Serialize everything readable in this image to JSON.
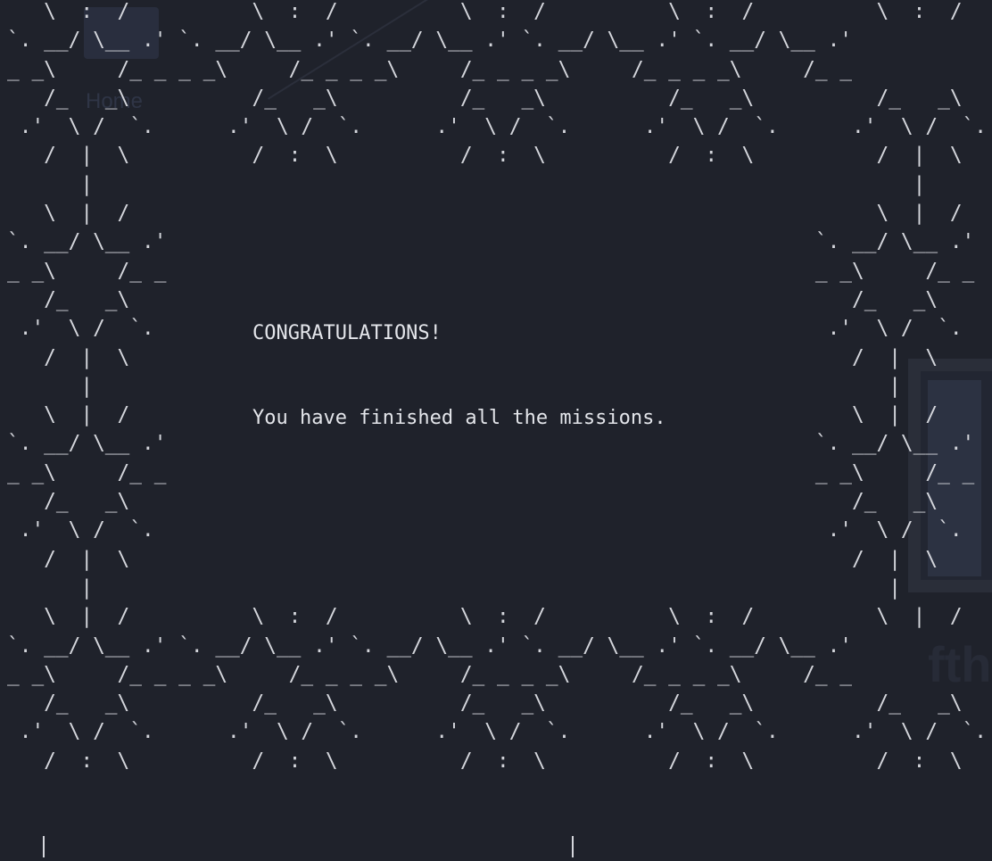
{
  "terminal": {
    "heading": "CONGRATULATIONS!",
    "message": "You have finished all the missions.",
    "ascii_border": "   \\  :  /          \\  :  /          \\  :  /          \\  :  /          \\  :  /\n`. __/ \\__ .' `. __/ \\__ .' `. __/ \\__ .' `. __/ \\__ .' `. __/ \\__ .'\n_ _\\     /_ _ _ _\\     /_ _ _ _\\     /_ _ _ _\\     /_ _ _ _\\     /_ _\n   /_   _\\          /_   _\\          /_   _\\          /_   _\\          /_   _\\\n .'  \\ /  `.      .'  \\ /  `.      .'  \\ /  `.      .'  \\ /  `.      .'  \\ /  `.\n   /  |  \\          /  :  \\          /  :  \\          /  :  \\          /  |  \\\n      |                                                                   |\n   \\  |  /                                                             \\  |  /\n`. __/ \\__ .'                                                     `. __/ \\__ .'\n_ _\\     /_ _                                                     _ _\\     /_ _\n   /_   _\\                                                           /_   _\\\n .'  \\ /  `.                                                       .'  \\ /  `.\n   /  |  \\                                                           /  |  \\\n      |                                                                 |\n   \\  |  /                                                           \\  |  /\n`. __/ \\__ .'                                                     `. __/ \\__ .'\n_ _\\     /_ _                                                     _ _\\     /_ _\n   /_   _\\                                                           /_   _\\\n .'  \\ /  `.                                                       .'  \\ /  `.\n   /  |  \\                                                           /  |  \\\n      |                                                                 |\n   \\  |  /          \\  :  /          \\  :  /          \\  :  /          \\  |  /\n`. __/ \\__ .' `. __/ \\__ .' `. __/ \\__ .' `. __/ \\__ .' `. __/ \\__ .'\n_ _\\     /_ _ _ _\\     /_ _ _ _\\     /_ _ _ _\\     /_ _ _ _\\     /_ _\n   /_   _\\          /_   _\\          /_   _\\          /_   _\\          /_   _\\\n .'  \\ /  `.      .'  \\ /  `.      .'  \\ /  `.      .'  \\ /  `.      .'  \\ /  `.\n   /  :  \\          /  :  \\          /  :  \\          /  :  \\          /  :  \\"
  },
  "background": {
    "desktop_icon_label": "Home",
    "colors": {
      "terminal_bg": "#1f222b",
      "text": "#d4d6dc"
    }
  }
}
